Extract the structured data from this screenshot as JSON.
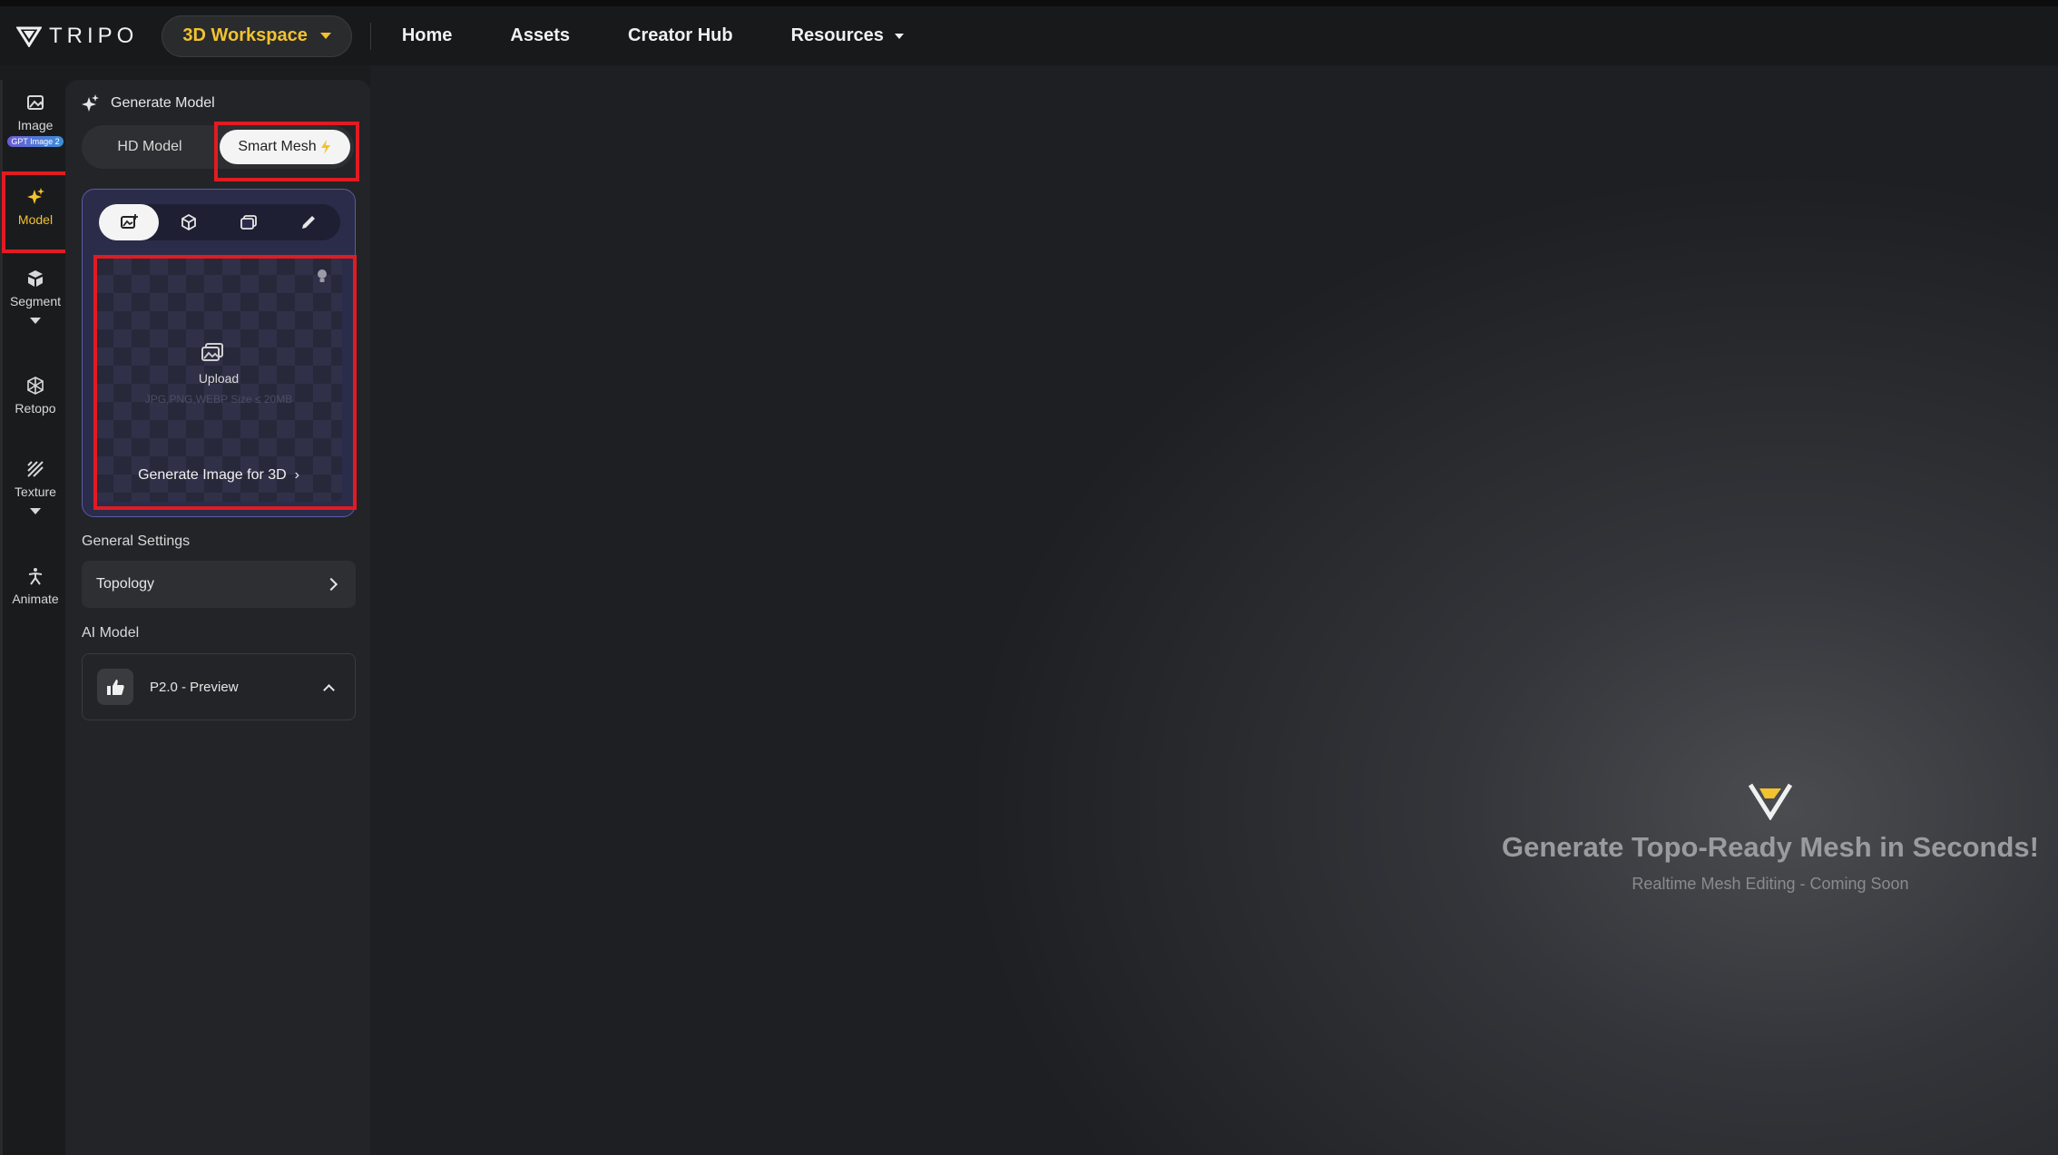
{
  "header": {
    "logo_text": "TRIPO",
    "workspace_label": "3D Workspace",
    "nav": [
      "Home",
      "Assets",
      "Creator Hub"
    ],
    "resources_label": "Resources"
  },
  "rail": {
    "image": {
      "label": "Image",
      "badge": "GPT Image 2"
    },
    "model": {
      "label": "Model"
    },
    "segment": {
      "label": "Segment"
    },
    "retopo": {
      "label": "Retopo"
    },
    "texture": {
      "label": "Texture"
    },
    "animate": {
      "label": "Animate"
    }
  },
  "panel": {
    "title": "Generate Model",
    "hd_model": "HD Model",
    "smart_mesh": "Smart Mesh",
    "upload_label": "Upload",
    "upload_hint": "JPG,PNG,WEBP Size ≤ 20MB",
    "generate_image_link": "Generate Image for 3D",
    "general_settings": "General Settings",
    "topology": "Topology",
    "ai_model_label": "AI Model",
    "ai_model_value": "P2.0 - Preview"
  },
  "canvas": {
    "title": "Generate Topo-Ready Mesh in Seconds!",
    "subtitle": "Realtime Mesh Editing - Coming Soon"
  },
  "colors": {
    "accent": "#f2c230",
    "highlight": "#e11b22",
    "card_border": "#5a5aa8"
  }
}
